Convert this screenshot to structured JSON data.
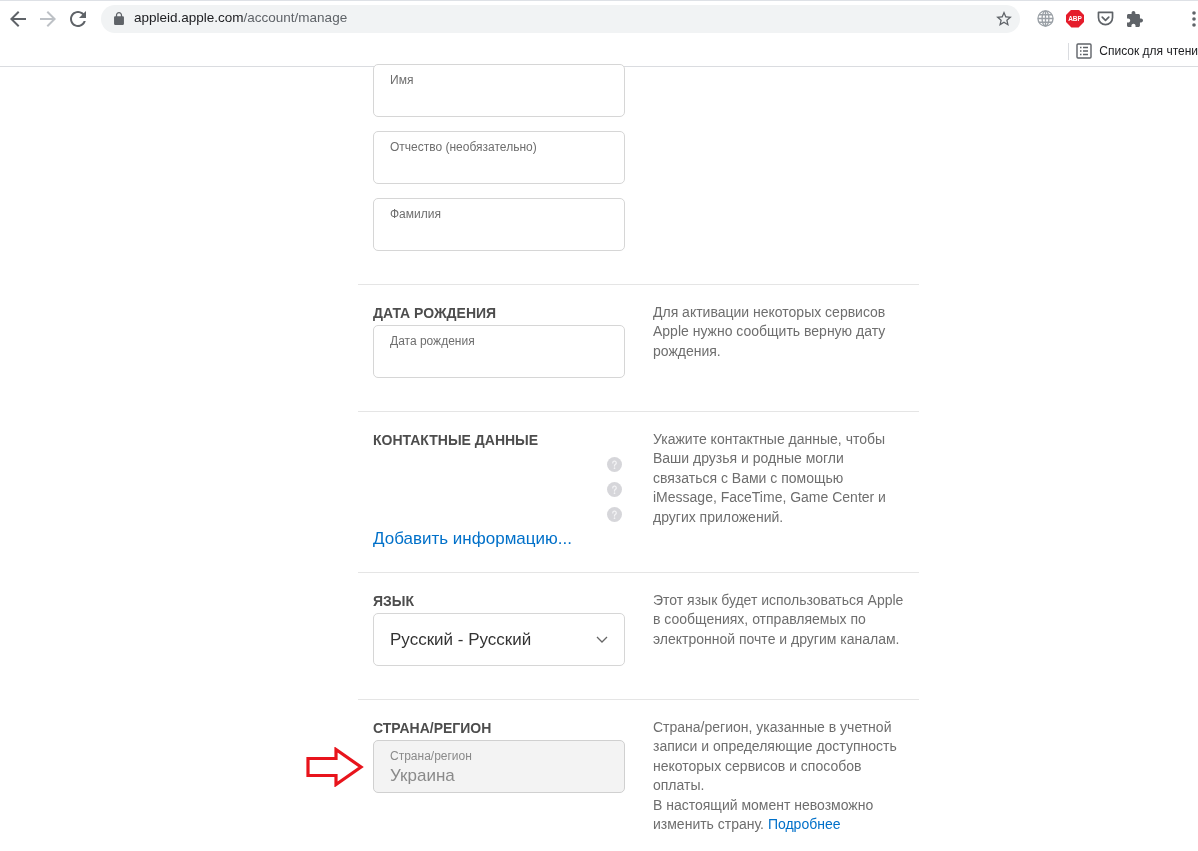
{
  "toolbar": {
    "nav_buttons": [
      {
        "kind": "back",
        "disabled": false
      },
      {
        "kind": "forward",
        "disabled": true
      },
      {
        "kind": "reload",
        "disabled": false
      }
    ],
    "address": {
      "host": "appleid.apple.com",
      "path": "/account/manage",
      "secure": true
    },
    "bookmarked": false,
    "extensions": [
      {
        "kind": "globe"
      },
      {
        "kind": "abp",
        "label": "ABP"
      },
      {
        "kind": "pocket"
      },
      {
        "kind": "puzzle"
      }
    ]
  },
  "bookmarks_bar": {
    "reading_list": "Список для чтени"
  },
  "sections": [
    {
      "kind": "fields",
      "fields": [
        {
          "label": "Имя",
          "disabled": false
        },
        {
          "label": "Отчество (необязательно)",
          "disabled": false
        },
        {
          "label": "Фамилия",
          "disabled": false
        }
      ]
    },
    {
      "kind": "fields",
      "heading": "ДАТА РОЖДЕНИЯ",
      "fields": [
        {
          "label": "Дата рождения",
          "disabled": false
        }
      ],
      "description": [
        {
          "text": "Для активации некоторых сервисов Apple нужно сообщить верную дату рождения."
        }
      ]
    },
    {
      "kind": "contacts",
      "heading": "КОНТАКТНЫЕ ДАННЫЕ",
      "help_rows": [
        {
          "help": true
        },
        {
          "help": true
        },
        {
          "help": true
        }
      ],
      "link": "Добавить информацию...",
      "description": [
        {
          "text": "Укажите контактные данные, чтобы Ваши друзья и родные могли связаться с Вами с помощью iMessage, FaceTime, Game Center и других приложений."
        }
      ]
    },
    {
      "kind": "select",
      "heading": "ЯЗЫК",
      "select": {
        "value": "Русский - Русский"
      },
      "description": [
        {
          "text": "Этот язык будет использоваться Apple в сообщениях, отправляемых по электронной почте и другим каналам."
        }
      ]
    },
    {
      "kind": "fields",
      "heading": "СТРАНА/РЕГИОН",
      "fields": [
        {
          "label": "Страна/регион",
          "value": "Украина",
          "disabled": true,
          "arrow": true
        }
      ],
      "description": [
        {
          "text": "Страна/регион, указанные в учетной записи и определяющие доступность некоторых сервисов и способов оплаты."
        },
        {
          "text": "В настоящий момент невозможно изменить страну.",
          "link": "Подробнее"
        }
      ]
    }
  ]
}
